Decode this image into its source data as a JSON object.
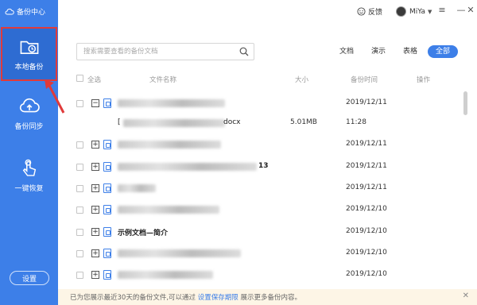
{
  "app": {
    "title": "备份中心"
  },
  "sidebar": {
    "items": [
      {
        "label": "本地备份",
        "icon": "folder-clock-icon",
        "active": true
      },
      {
        "label": "备份同步",
        "icon": "cloud-upload-icon"
      },
      {
        "label": "一键恢复",
        "icon": "hand-pointer-icon"
      }
    ],
    "settings_label": "设置"
  },
  "topbar": {
    "feedback_label": "反馈",
    "user_name": "MiYa"
  },
  "search": {
    "placeholder": "搜索需要查看的备份文档"
  },
  "filters": {
    "doc": "文档",
    "ppt": "演示",
    "xls": "表格",
    "all": "全部"
  },
  "table": {
    "headers": {
      "select_all": "全选",
      "name": "文件名称",
      "size": "大小",
      "time": "备份时间",
      "action": "操作"
    },
    "rows": [
      {
        "toggle": "−",
        "time": "2019/12/11"
      },
      {
        "sub": true,
        "name_suffix": "docx",
        "size": "5.01MB",
        "time": "11:28"
      },
      {
        "toggle": "+",
        "time": "2019/12/11"
      },
      {
        "toggle": "+",
        "name_suffix": "13",
        "time": "2019/12/11"
      },
      {
        "toggle": "+",
        "time": "2019/12/11"
      },
      {
        "toggle": "+",
        "time": "2019/12/10"
      },
      {
        "toggle": "+",
        "name": "示例文档—简介",
        "time": "2019/12/10"
      },
      {
        "toggle": "+",
        "time": "2019/12/10"
      },
      {
        "toggle": "+",
        "time": "2019/12/10"
      }
    ]
  },
  "footer": {
    "message_before": "已为您展示最近30天的备份文件,可以通过",
    "link": "设置保存期限",
    "message_after": "展示更多备份内容。"
  },
  "colors": {
    "accent": "#3d7fe8",
    "highlight_border": "#e03a3a",
    "footer_bg": "#fdf5e6"
  }
}
